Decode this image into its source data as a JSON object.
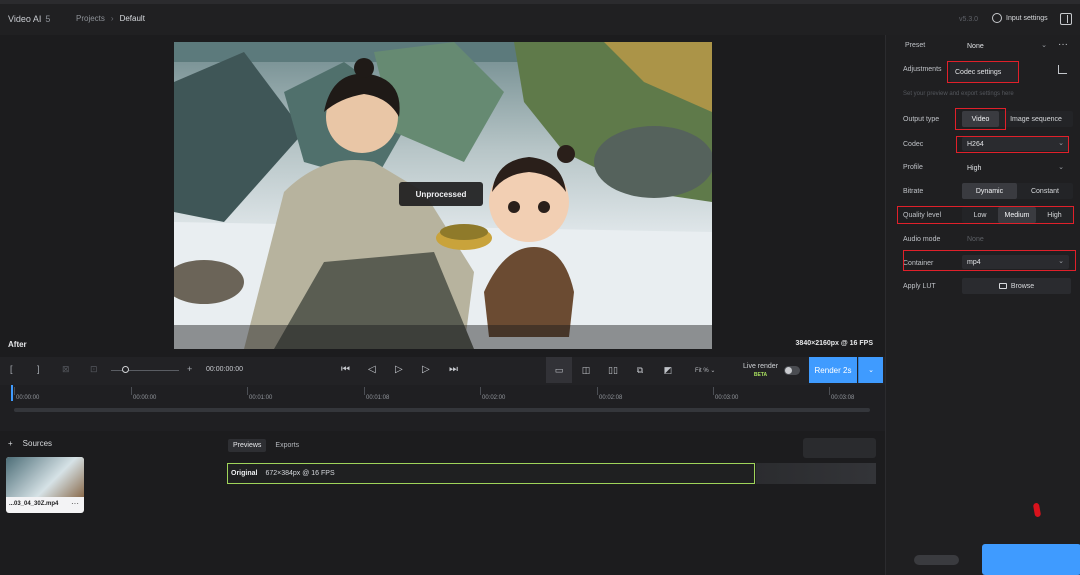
{
  "topbar": {
    "app_title": "Video AI",
    "app_version_badge": "5",
    "breadcrumb": {
      "projects": "Projects",
      "separator": "›",
      "current": "Default"
    },
    "version": "v5.3.0",
    "input_settings_label": "Input settings"
  },
  "viewer": {
    "badge": "Unprocessed",
    "label": "After",
    "resolution": "3840×2160px @ 16 FPS"
  },
  "toolbar": {
    "mark_in": "[",
    "mark_out": "]",
    "timecode": "00:00:00:00",
    "zoom_plus": "+",
    "fit_label": "Fit %",
    "live_render_label": "Live render",
    "beta_label": "BETA",
    "render_label": "Render 2s"
  },
  "timeline": {
    "ticks": [
      "00:00:00",
      "00:00:00",
      "00:01:00",
      "00:01:08",
      "00:02:00",
      "00:02:08",
      "00:03:00",
      "00:03:08"
    ]
  },
  "bottom": {
    "sources_label": "Sources",
    "add_symbol": "+",
    "source_file": "...03_04_30Z.mp4",
    "more_symbol": "···",
    "tabs": [
      "Previews",
      "Exports"
    ],
    "original_label": "Original",
    "original_info": "672×384px @ 16 FPS"
  },
  "settings": {
    "preset_label": "Preset",
    "preset_value": "None",
    "adjustments_label": "Adjustments",
    "codec_settings_tab": "Codec settings",
    "hint": "Set your preview and export settings here",
    "output_type_label": "Output type",
    "output_type_options": [
      "Video",
      "Image sequence"
    ],
    "codec_label": "Codec",
    "codec_value": "H264",
    "profile_label": "Profile",
    "profile_value": "High",
    "bitrate_label": "Bitrate",
    "bitrate_options": [
      "Dynamic",
      "Constant"
    ],
    "quality_label": "Quality level",
    "quality_options": [
      "Low",
      "Medium",
      "High"
    ],
    "audio_label": "Audio mode",
    "audio_value": "None",
    "container_label": "Container",
    "container_value": "mp4",
    "lut_label": "Apply LUT",
    "browse_label": "Browse"
  },
  "colors": {
    "accent": "#3f9bff",
    "highlight_box": "#e0202a",
    "track_outline": "#9fd45a"
  }
}
